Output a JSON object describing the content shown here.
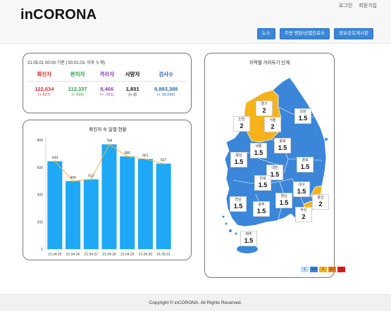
{
  "app": {
    "logo": "inCORONA",
    "auth": {
      "login": "로그인",
      "signup": "회원가입"
    },
    "nav": {
      "news": "뉴스",
      "hospitals": "주변 병원/선별진료소",
      "board": "정보공유게시판"
    }
  },
  "stats": {
    "date": "21.05.01 00:00 기준 ('20.01.03. 이후 누계)",
    "columns": [
      {
        "label": "확진자",
        "value": "122,634",
        "change": "(+ 627)",
        "color": "#d32f2f"
      },
      {
        "label": "완치자",
        "value": "112,337",
        "change": "(+ 915)",
        "color": "#2e9b3f"
      },
      {
        "label": "격리자",
        "value": "8,466",
        "change": "(+ -291)",
        "color": "#8e3bb5"
      },
      {
        "label": "사망자",
        "value": "1,831",
        "change": "(+ 3)",
        "color": "#111111"
      },
      {
        "label": "검사수",
        "value": "8,883,388",
        "change": "(+ 35,096)",
        "color": "#2f6db5"
      }
    ]
  },
  "chart_data": {
    "type": "bar",
    "title": "확진자 수 일별 현황",
    "categories": [
      "21.04.25",
      "21.04.26",
      "21.04.27",
      "21.04.28",
      "21.04.29",
      "21.04.30",
      "21.05.01"
    ],
    "values": [
      644,
      499,
      512,
      768,
      680,
      661,
      627
    ],
    "data_labels": [
      "644",
      "499",
      "512",
      "768",
      "680",
      "661",
      "627"
    ],
    "yticks": [
      "0",
      "200",
      "400",
      "600",
      "800"
    ],
    "ylim": [
      0,
      800
    ],
    "overlay_line": true,
    "grid": false,
    "bar_color": "#1ea8f5",
    "line_color": "#f5b342"
  },
  "map": {
    "title": "지역별 거리두기 단계",
    "regions": [
      {
        "key": "gyeonggi",
        "name": "경기",
        "level": "2"
      },
      {
        "key": "seoul",
        "name": "서울",
        "level": "2"
      },
      {
        "key": "incheon",
        "name": "인천",
        "level": "2"
      },
      {
        "key": "gangwon",
        "name": "강원",
        "level": "1.5"
      },
      {
        "key": "sejong",
        "name": "세종",
        "level": "1.5"
      },
      {
        "key": "chungbuk",
        "name": "충북",
        "level": "1.5"
      },
      {
        "key": "chungnam",
        "name": "충남",
        "level": "1.5"
      },
      {
        "key": "gyeongbuk",
        "name": "경북",
        "level": "1.5"
      },
      {
        "key": "daejeon",
        "name": "대전",
        "level": "1.5"
      },
      {
        "key": "jeonbuk",
        "name": "전북",
        "level": "1.5"
      },
      {
        "key": "daegu",
        "name": "대구",
        "level": "1.5"
      },
      {
        "key": "ulsan",
        "name": "울산",
        "level": "2"
      },
      {
        "key": "jeonnam",
        "name": "전남",
        "level": "1.5"
      },
      {
        "key": "gwangju",
        "name": "광주",
        "level": "1.5"
      },
      {
        "key": "gyeongnam",
        "name": "경남",
        "level": "1.5"
      },
      {
        "key": "busan",
        "name": "부산",
        "level": "2"
      },
      {
        "key": "jeju",
        "name": "제주",
        "level": "1.5"
      }
    ],
    "legend": [
      {
        "label": "1",
        "color": "#b9dff7"
      },
      {
        "label": "1.5",
        "color": "#3b86d8"
      },
      {
        "label": "2",
        "color": "#f5b21b"
      },
      {
        "label": "2.5",
        "color": "#f07d18"
      },
      {
        "label": "3",
        "color": "#e01818"
      }
    ]
  },
  "footer": {
    "text": "Copyright © inCORONA. All Rights Reserved."
  }
}
